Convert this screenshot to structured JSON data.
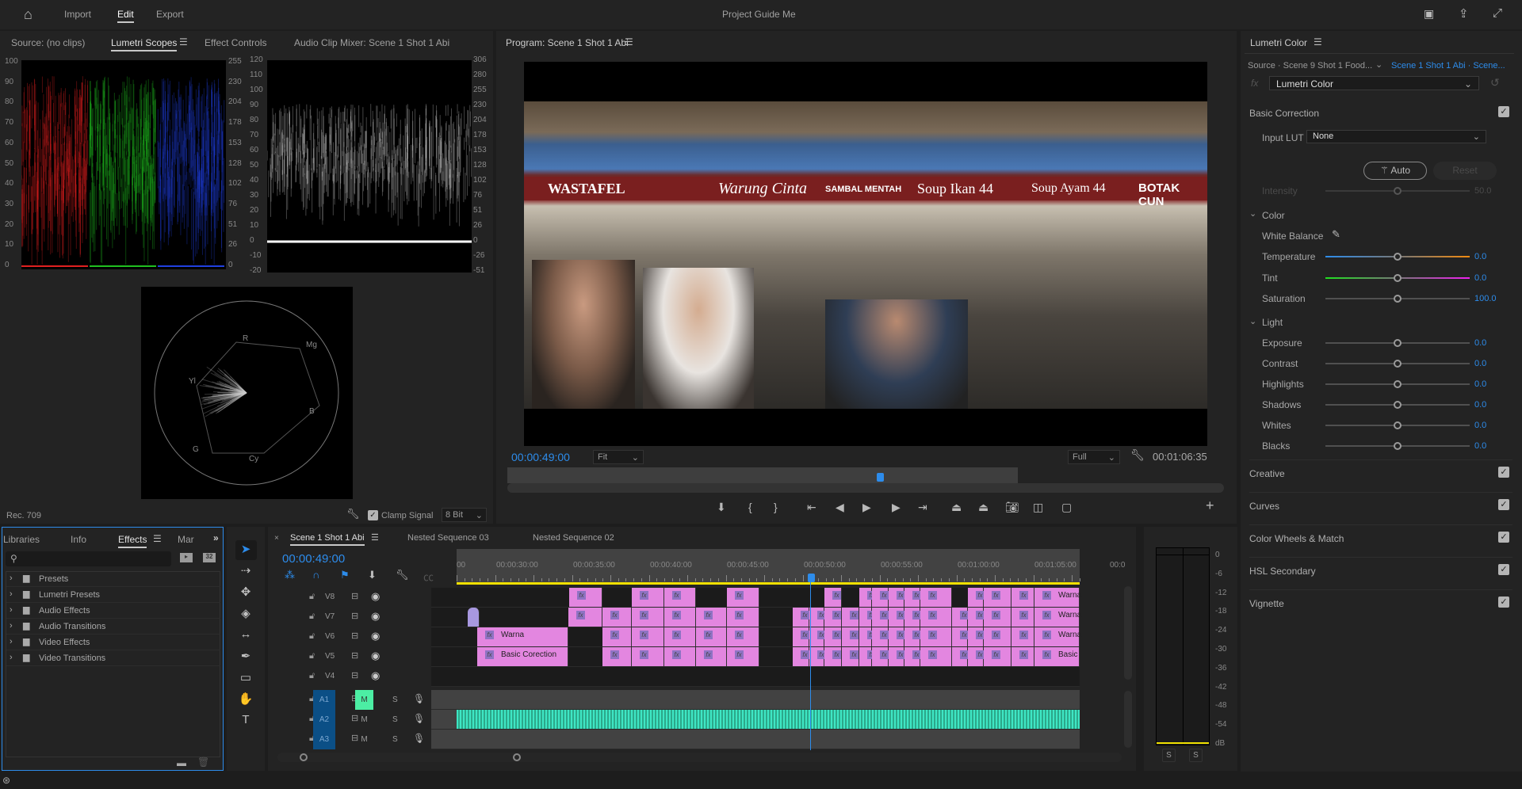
{
  "app": {
    "title": "Project Guide Me",
    "nav": [
      "Import",
      "Edit",
      "Export"
    ],
    "active_nav": "Edit"
  },
  "colors": {
    "accent": "#2d8ceb",
    "clip": "#e386e0",
    "audio": "#3ee6c4",
    "playhead_marker": "#2d8ceb",
    "work_area": "#f0e000"
  },
  "left_panel": {
    "tabs": [
      "Source: (no clips)",
      "Lumetri Scopes",
      "Effect Controls",
      "Audio Clip Mixer: Scene 1 Shot 1 Abi"
    ],
    "active_tab": "Lumetri Scopes",
    "parade_left_ticks": [
      "100",
      "90",
      "80",
      "70",
      "60",
      "50",
      "40",
      "30",
      "20",
      "10",
      "0"
    ],
    "parade_right_ticks": [
      "255",
      "230",
      "204",
      "178",
      "153",
      "128",
      "102",
      "76",
      "51",
      "26",
      "0"
    ],
    "wave_left_ticks": [
      "120",
      "110",
      "100",
      "90",
      "80",
      "70",
      "60",
      "50",
      "40",
      "30",
      "20",
      "10",
      "0",
      "-10",
      "-20"
    ],
    "wave_right_ticks": [
      "306",
      "280",
      "255",
      "230",
      "204",
      "178",
      "153",
      "128",
      "102",
      "76",
      "51",
      "26",
      "0",
      "-26",
      "-51"
    ],
    "vector_labels": [
      "R",
      "Mg",
      "B",
      "Cy",
      "G",
      "Yl"
    ],
    "colorspace": "Rec. 709",
    "clamp_label": "Clamp Signal",
    "clamp_checked": true,
    "bit_depth": "8 Bit"
  },
  "program": {
    "title": "Program: Scene 1 Shot 1 Abi",
    "timecode": "00:00:49:00",
    "zoom": "Fit",
    "quality": "Full",
    "duration": "00:01:06:35",
    "signs": [
      "WASTAFEL",
      "Warung Cinta",
      "SAMBAL MENTAH",
      "Soup Ikan 44",
      "Soup Ayam 44",
      "BOTAK CUN"
    ]
  },
  "lumetri": {
    "title": "Lumetri Color",
    "source": "Source · Scene 9 Shot 1 Food...",
    "target": "Scene 1 Shot 1 Abi · Scene...",
    "effect": "Lumetri Color",
    "basic_correction": "Basic Correction",
    "input_lut_label": "Input LUT",
    "input_lut": "None",
    "auto": "Auto",
    "reset": "Reset",
    "intensity": {
      "label": "Intensity",
      "value": "50.0"
    },
    "color_section": "Color",
    "white_balance": "White Balance",
    "color_sliders": [
      {
        "label": "Temperature",
        "value": "0.0"
      },
      {
        "label": "Tint",
        "value": "0.0"
      },
      {
        "label": "Saturation",
        "value": "100.0"
      }
    ],
    "light_section": "Light",
    "light_sliders": [
      {
        "label": "Exposure",
        "value": "0.0"
      },
      {
        "label": "Contrast",
        "value": "0.0"
      },
      {
        "label": "Highlights",
        "value": "0.0"
      },
      {
        "label": "Shadows",
        "value": "0.0"
      },
      {
        "label": "Whites",
        "value": "0.0"
      },
      {
        "label": "Blacks",
        "value": "0.0"
      }
    ],
    "sections": [
      {
        "label": "Creative",
        "checked": true
      },
      {
        "label": "Curves",
        "checked": true
      },
      {
        "label": "Color Wheels & Match",
        "checked": true
      },
      {
        "label": "HSL Secondary",
        "checked": true
      },
      {
        "label": "Vignette",
        "checked": true
      }
    ]
  },
  "effects_panel": {
    "tabs": [
      "Libraries",
      "Info",
      "Effects",
      "Mar"
    ],
    "active_tab": "Effects",
    "search_placeholder": "",
    "items": [
      "Presets",
      "Lumetri Presets",
      "Audio Effects",
      "Audio Transitions",
      "Video Effects",
      "Video Transitions"
    ]
  },
  "timeline": {
    "tabs": [
      "Scene 1 Shot 1 Abi",
      "Nested Sequence 03",
      "Nested Sequence 02"
    ],
    "active_tab": "Scene 1 Shot 1 Abi",
    "timecode": "00:00:49:00",
    "ruler": [
      "00",
      "00:00:30:00",
      "00:00:35:00",
      "00:00:40:00",
      "00:00:45:00",
      "00:00:50:00",
      "00:00:55:00",
      "00:01:00:00",
      "00:01:05:00",
      "00:0"
    ],
    "video_tracks": [
      "V8",
      "V7",
      "V6",
      "V5",
      "V4"
    ],
    "audio_tracks": [
      {
        "name": "A1",
        "mute": true
      },
      {
        "name": "A2",
        "mute": false
      },
      {
        "name": "A3",
        "mute": false
      }
    ],
    "mute_label": "M",
    "solo_label": "S",
    "clip_labels": {
      "v6_first": "Warna",
      "v5_first": "Basic Corection",
      "end_v8": "Warna",
      "end_v7": "Warna",
      "end_v6": "Warna",
      "end_v5": "Basic"
    }
  },
  "meters": {
    "ticks": [
      "0",
      "-6",
      "-12",
      "-18",
      "-24",
      "-30",
      "-36",
      "-42",
      "-48",
      "-54",
      "dB"
    ],
    "solo": [
      "S",
      "S"
    ]
  }
}
